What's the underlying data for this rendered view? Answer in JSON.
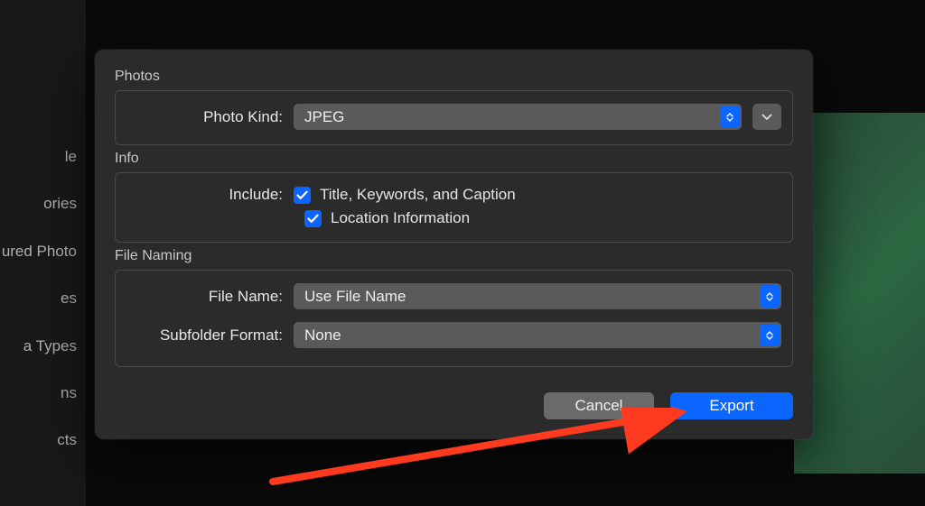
{
  "sidebar": {
    "items": [
      "le",
      "ories",
      "ured Photo",
      "es",
      "a Types",
      "ns",
      "cts"
    ]
  },
  "dialog": {
    "sections": {
      "photos": {
        "label": "Photos",
        "photo_kind": {
          "label": "Photo Kind:",
          "value": "JPEG"
        }
      },
      "info": {
        "label": "Info",
        "include_label": "Include:",
        "title_keywords": {
          "checked": true,
          "label": "Title, Keywords, and Caption"
        },
        "location": {
          "checked": true,
          "label": "Location Information"
        }
      },
      "file_naming": {
        "label": "File Naming",
        "file_name": {
          "label": "File Name:",
          "value": "Use File Name"
        },
        "subfolder": {
          "label": "Subfolder Format:",
          "value": "None"
        }
      }
    },
    "buttons": {
      "cancel": "Cancel",
      "export": "Export"
    }
  }
}
